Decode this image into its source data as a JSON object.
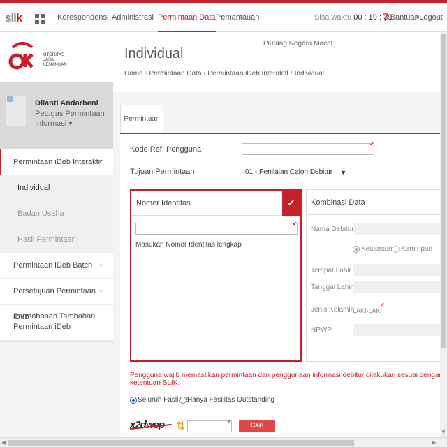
{
  "topbar": {
    "brand": "slik",
    "nav": [
      "Korespondensi",
      "Administrasi",
      "Permintaan Data",
      "Pemantauan"
    ],
    "active_nav": "Permintaan Data",
    "sisa_label": "Sisa waktu",
    "sisa_value": "00 : 19 : 39",
    "bantuan": "Bantuan",
    "logout": "Logout"
  },
  "logo": {
    "mark": "OJK",
    "lines": [
      "OTORITAS",
      "JASA",
      "KEUANGAN"
    ]
  },
  "user": {
    "name": "Dilanti Andarbeni",
    "role": "Petugas Permintaan Informasi ▾"
  },
  "sidebar": {
    "items": [
      {
        "label": "Permintaan iDeb Interaktif",
        "chev": "‹"
      },
      {
        "label": "Individual"
      },
      {
        "label": "Badan Usaha"
      },
      {
        "label": "Hasil Permintaan"
      },
      {
        "label": "Permintaan iDeb Batch",
        "chev": "‹"
      },
      {
        "label": "Persetujuan Permintaan iDeb",
        "chev": "‹"
      },
      {
        "label": "Permohonan Tambahan Permintaan iDeb"
      }
    ]
  },
  "page": {
    "title": "Individual",
    "subtitle": "Piutang Negara Macet",
    "breadcrumb": [
      "Home",
      "Permintaan Data",
      "Permintaan iDeb Interaktif",
      "Individual"
    ]
  },
  "tab": {
    "label": "Permintaan"
  },
  "form": {
    "kode_ref_label": "Kode Ref. Pengguna",
    "kode_ref_value": "",
    "tujuan_label": "Tujuan Permintaan",
    "tujuan_value": "01 - Penilaian Calon Debitur"
  },
  "nomor_box": {
    "title": "Nomor Identitas",
    "input_value": "",
    "hint": "Masukan Nomor Identitas lengkap"
  },
  "kombinasi_box": {
    "title": "Kombinasi Data",
    "nama_label": "Nama Debitur",
    "kesamaan": "Kesamaan",
    "kemiripan": "Kemiripan",
    "tempat_label": "Tempat Lahir",
    "tanggal_label": "Tanggal Lahir",
    "jenis_label": "Jenis Kelamin",
    "jenis_value": "LAKI-LAKI",
    "npwp_label": "NPWP"
  },
  "notice": "Pengguna wajib memastikan permintaan dan penggunaan informasi debitur dilakukan sesuai dengan ketentuan SLIK.",
  "fasilitas": {
    "seluruh": "Seluruh Fasilitas",
    "hanya": "Hanya Fasilitas Outstanding"
  },
  "captcha": {
    "text": "x2dwep",
    "button": "Cari"
  },
  "colors": {
    "accent": "#c8202a"
  }
}
